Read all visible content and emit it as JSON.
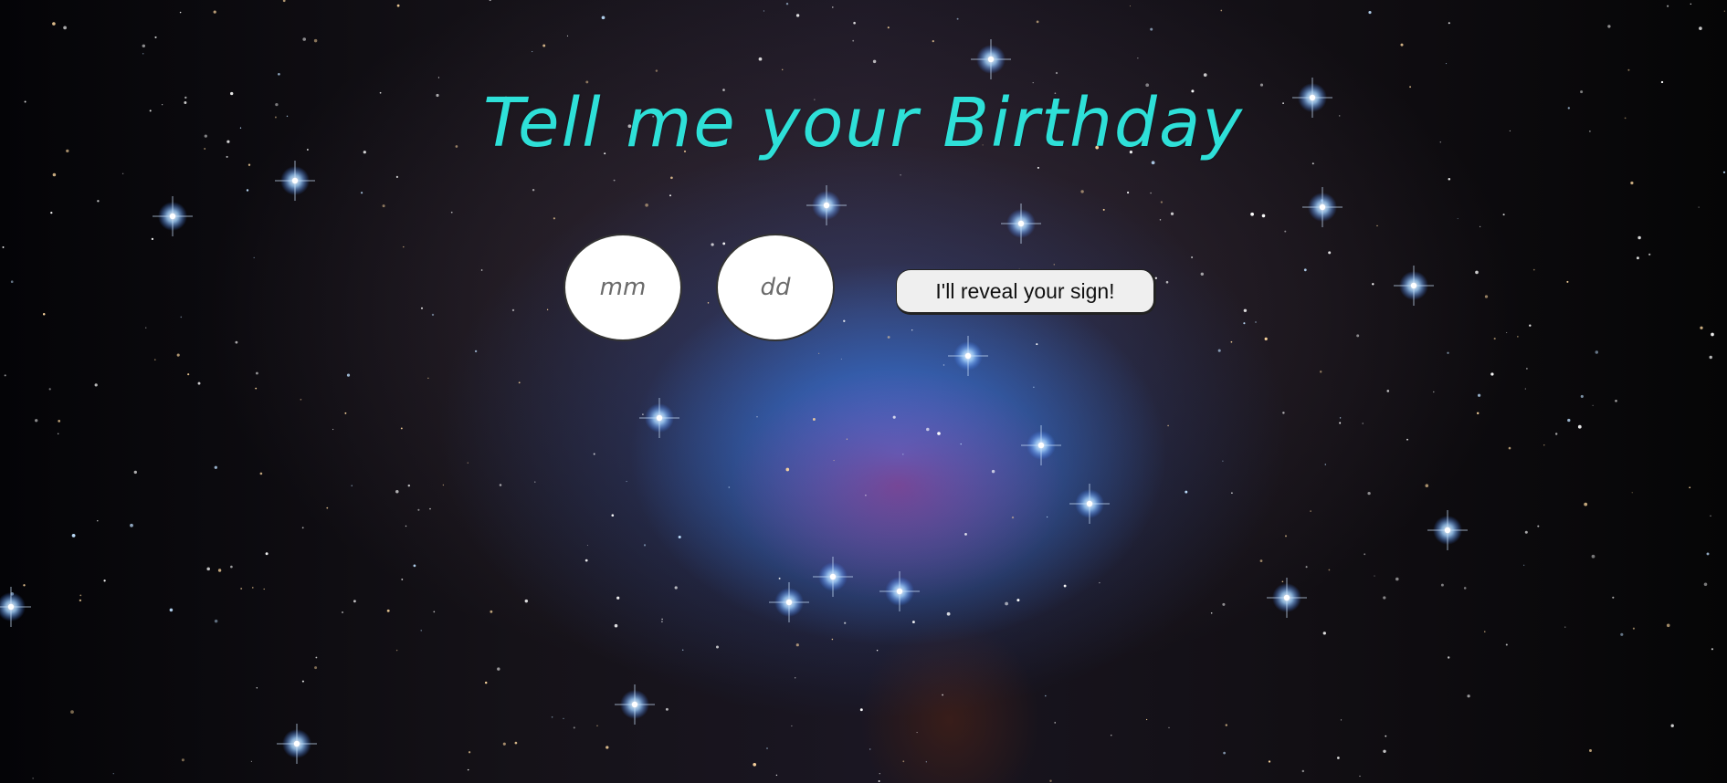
{
  "heading": {
    "title": "Tell me your Birthday"
  },
  "form": {
    "month": {
      "placeholder": "mm",
      "value": ""
    },
    "day": {
      "placeholder": "dd",
      "value": ""
    },
    "submit_label": "I'll reveal your sign!"
  },
  "colors": {
    "title": "#2ee0d8",
    "button_background": "#efefef",
    "input_background": "#ffffff"
  },
  "background": {
    "description_icon": "nebula-starfield-background"
  }
}
